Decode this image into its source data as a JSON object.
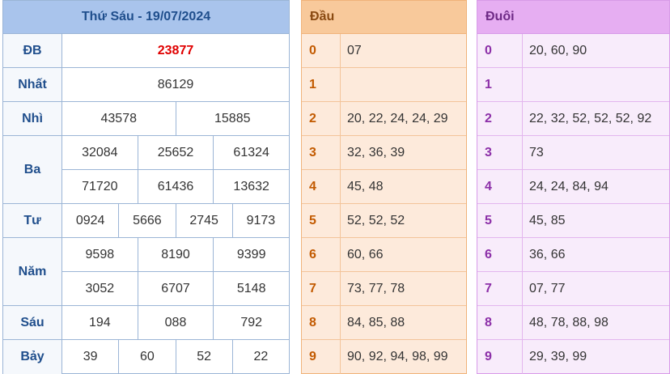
{
  "results": {
    "title": "Thứ Sáu - 19/07/2024",
    "prizes": {
      "db": {
        "label": "ĐB",
        "values": [
          "23877"
        ]
      },
      "nhat": {
        "label": "Nhất",
        "values": [
          "86129"
        ]
      },
      "nhi": {
        "label": "Nhì",
        "values": [
          "43578",
          "15885"
        ]
      },
      "ba": {
        "label": "Ba",
        "values": [
          "32084",
          "25652",
          "61324",
          "71720",
          "61436",
          "13632"
        ]
      },
      "tu": {
        "label": "Tư",
        "values": [
          "0924",
          "5666",
          "2745",
          "9173"
        ]
      },
      "nam": {
        "label": "Năm",
        "values": [
          "9598",
          "8190",
          "9399",
          "3052",
          "6707",
          "5148"
        ]
      },
      "sau": {
        "label": "Sáu",
        "values": [
          "194",
          "088",
          "792"
        ]
      },
      "bay": {
        "label": "Bảy",
        "values": [
          "39",
          "60",
          "52",
          "22"
        ]
      }
    }
  },
  "dau": {
    "header": "Đầu",
    "rows": [
      {
        "key": "0",
        "values": "07"
      },
      {
        "key": "1",
        "values": ""
      },
      {
        "key": "2",
        "values": "20, 22, 24, 24, 29"
      },
      {
        "key": "3",
        "values": "32, 36, 39"
      },
      {
        "key": "4",
        "values": "45, 48"
      },
      {
        "key": "5",
        "values": "52, 52, 52"
      },
      {
        "key": "6",
        "values": "60, 66"
      },
      {
        "key": "7",
        "values": "73, 77, 78"
      },
      {
        "key": "8",
        "values": "84, 85, 88"
      },
      {
        "key": "9",
        "values": "90, 92, 94, 98, 99"
      }
    ]
  },
  "duoi": {
    "header": "Đuôi",
    "rows": [
      {
        "key": "0",
        "values": "20, 60, 90"
      },
      {
        "key": "1",
        "values": ""
      },
      {
        "key": "2",
        "values": "22, 32, 52, 52, 52, 92"
      },
      {
        "key": "3",
        "values": "73"
      },
      {
        "key": "4",
        "values": "24, 24, 84, 94"
      },
      {
        "key": "5",
        "values": "45, 85"
      },
      {
        "key": "6",
        "values": "36, 66"
      },
      {
        "key": "7",
        "values": "07, 77"
      },
      {
        "key": "8",
        "values": "48, 78, 88, 98"
      },
      {
        "key": "9",
        "values": "29, 39, 99"
      }
    ]
  },
  "colors": {
    "special_prize": "#e00000",
    "results_header": "#a9c4ec",
    "dau_header": "#f8c99b",
    "duoi_header": "#e6aef2"
  }
}
